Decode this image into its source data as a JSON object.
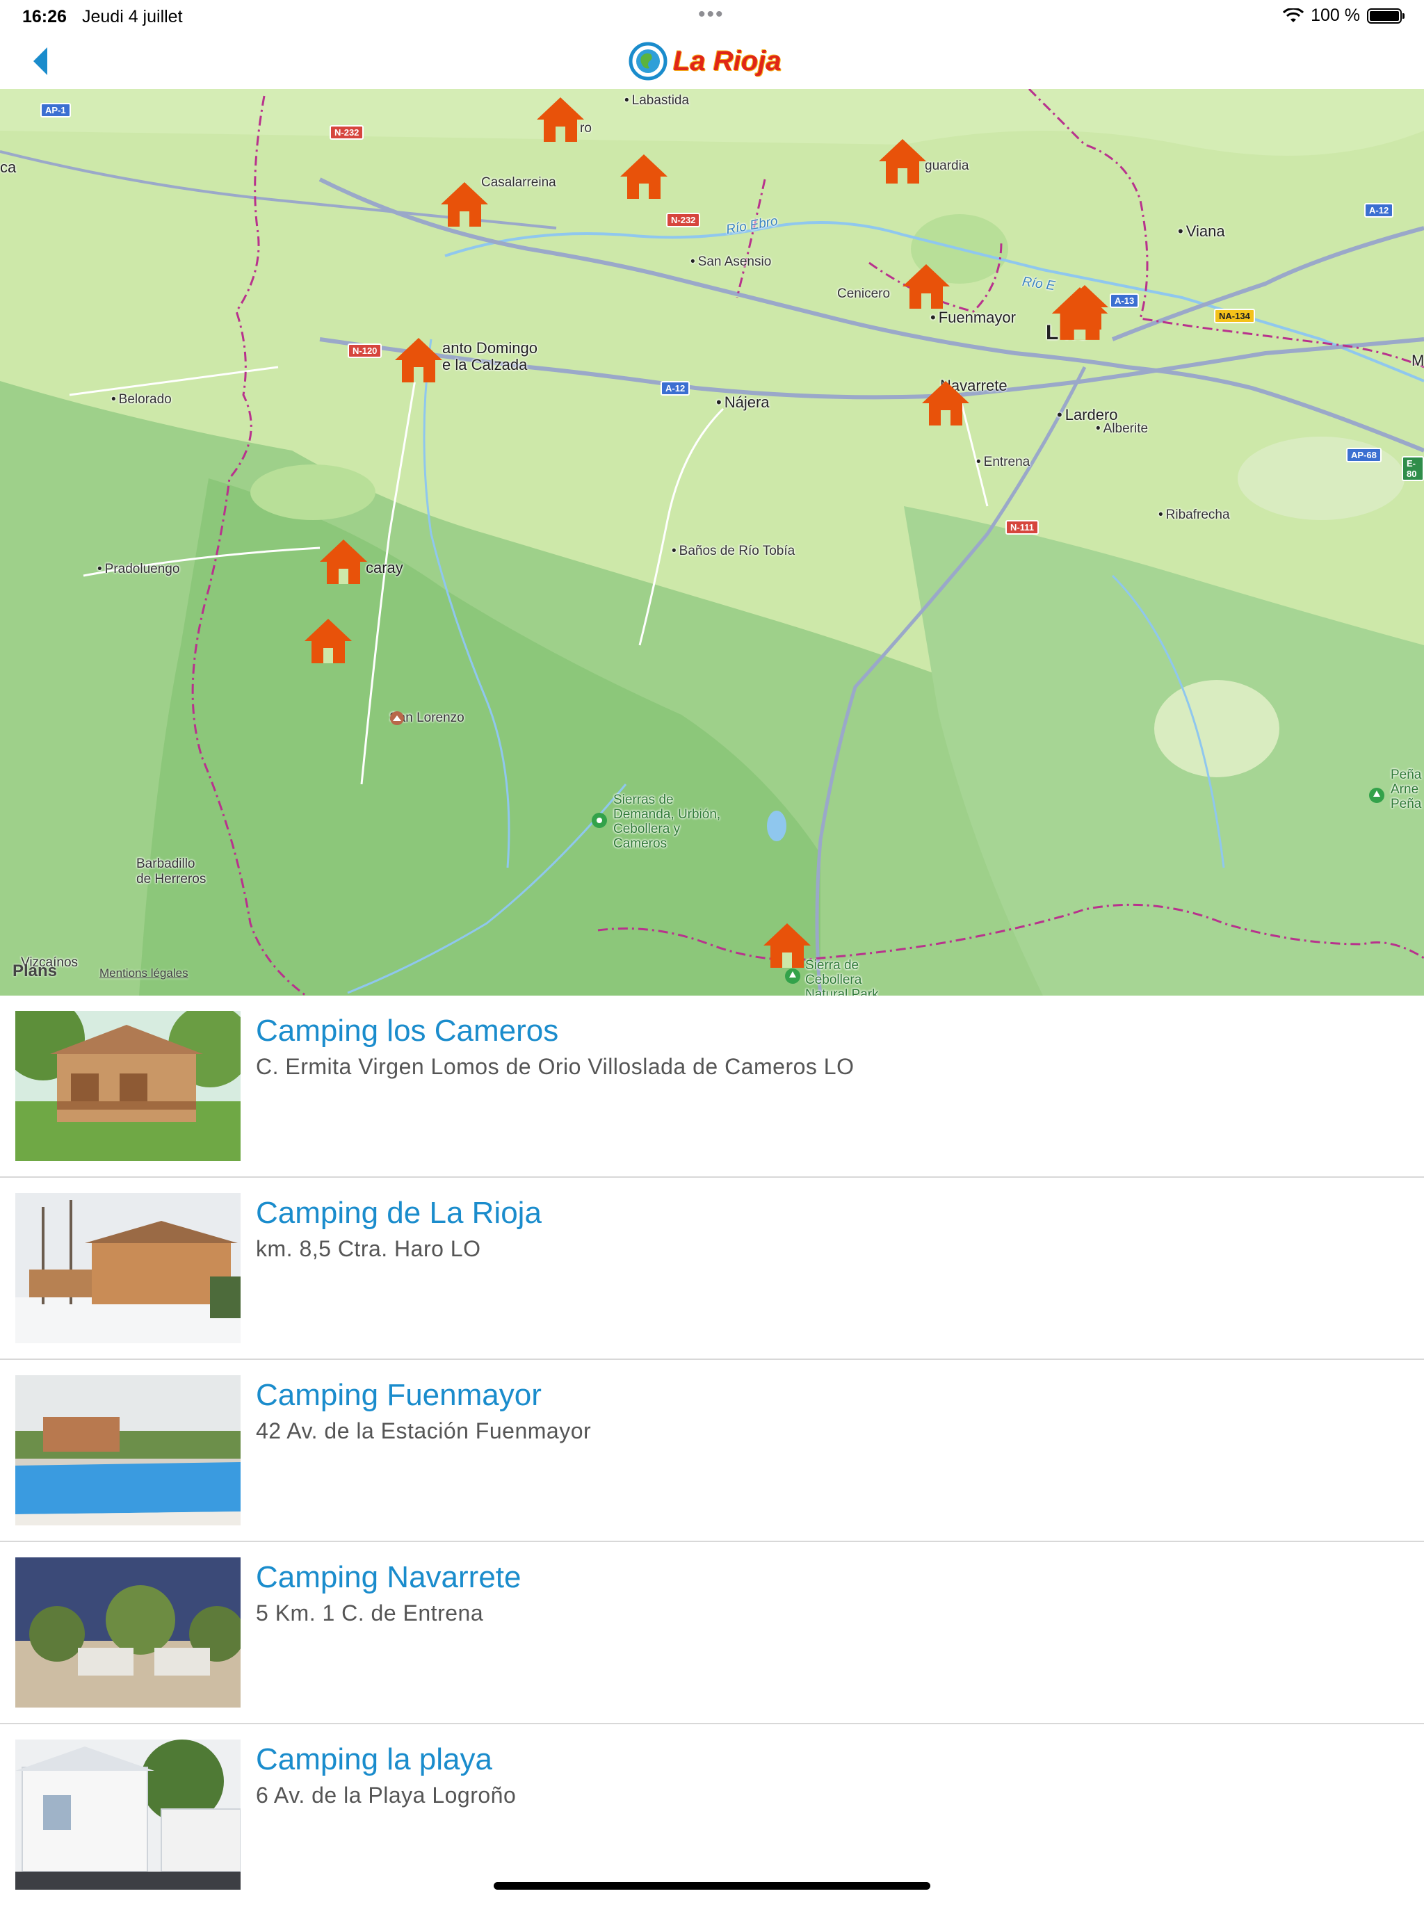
{
  "status_bar": {
    "time": "16:26",
    "date": "Jeudi 4 juillet",
    "battery": "100 %"
  },
  "header": {
    "title": "La Rioja",
    "back_icon": "chevron-left-icon",
    "accent": "#1a8ccc"
  },
  "map": {
    "attribution": "Plans",
    "legal_link": "Mentions légales",
    "marker_color": "#e8520a",
    "markers_count": 12,
    "places": {
      "labastida": "Labastida",
      "haro": "ro",
      "casalarreina": "Casalarreina",
      "laguardia": "guardia",
      "viana": "Viana",
      "san_asensio": "San Asensio",
      "cenicero": "Cenicero",
      "fuenmayor": "Fuenmayor",
      "logrono": "L  ño",
      "santo_domingo_1": "anto Domingo",
      "santo_domingo_2": "e la Calzada",
      "belorado": "Belorado",
      "najera": "Nájera",
      "navarrete": "Navarrete",
      "lardero": "Lardero",
      "alberite": "Alberite",
      "entrena": "Entrena",
      "ribafrecha": "Ribafrecha",
      "pradoluengo": "Pradoluengo",
      "ezcaray": "caray",
      "banos": "Baños de Río Tobía",
      "san_lorenzo": "San Lorenzo",
      "sierras_1": "Sierras de",
      "sierras_2": "Demanda, Urbión,",
      "sierras_3": "Cebollera y",
      "sierras_4": "Cameros",
      "barbadillo_1": "Barbadillo",
      "barbadillo_2": "de Herreros",
      "vizcainos": "Vizcaínos",
      "cebollera_1": "Sierra de",
      "cebollera_2": "Cebollera",
      "cebollera_3": "Natural Park",
      "pena_1": "Peña",
      "pena_2": "Arne",
      "pena_3": "Peña",
      "ca": "ca",
      "m": "M",
      "rio_ebro": "Río Ebro",
      "rio_ebro_2": "Río E"
    },
    "shields": {
      "ap1": "AP-1",
      "n232a": "N-232",
      "n232b": "N-232",
      "a12a": "A-12",
      "a12b": "A-12",
      "n120": "N-120",
      "a13": "A-13",
      "na134": "NA-134",
      "ap68": "AP-68",
      "n111": "N-111",
      "e80": "E-80"
    }
  },
  "campings": [
    {
      "name": "Camping los Cameros",
      "address": "C. Ermita Virgen Lomos de Orio Villoslada de Cameros LO"
    },
    {
      "name": "Camping de La Rioja",
      "address": "km. 8,5 Ctra. Haro LO"
    },
    {
      "name": "Camping Fuenmayor",
      "address": "42 Av. de la Estación Fuenmayor"
    },
    {
      "name": "Camping Navarrete",
      "address": "5 Km. 1 C. de Entrena"
    },
    {
      "name": "Camping la playa",
      "address": "6 Av. de la Playa Logroño"
    }
  ]
}
